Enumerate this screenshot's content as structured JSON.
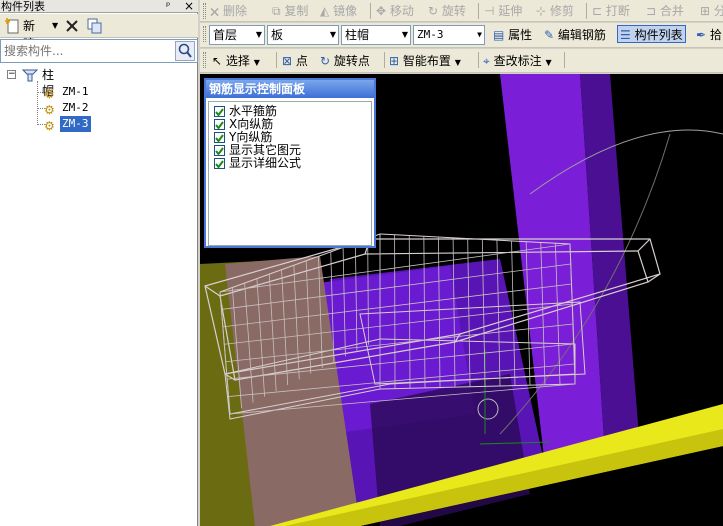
{
  "left_panel": {
    "title": "构件列表",
    "pin_glyph": "ᵖ",
    "close_glyph": "×",
    "new_label": "新建",
    "search_placeholder": "搜索构件...",
    "tree": {
      "root_label": "柱帽",
      "children": [
        "ZM-1",
        "ZM-2",
        "ZM-3"
      ],
      "selected_index": 2
    }
  },
  "toolbar1": {
    "buttons": [
      {
        "label": "删除",
        "enabled": false,
        "icon": "delete-icon"
      },
      {
        "label": "复制",
        "enabled": false,
        "icon": "copy-icon"
      },
      {
        "label": "镜像",
        "enabled": false,
        "icon": "mirror-icon"
      },
      {
        "label": "移动",
        "enabled": false,
        "icon": "move-icon"
      },
      {
        "label": "旋转",
        "enabled": false,
        "icon": "rotate-icon"
      },
      {
        "label": "延伸",
        "enabled": false,
        "icon": "extend-icon"
      },
      {
        "label": "修剪",
        "enabled": false,
        "icon": "trim-icon"
      },
      {
        "label": "打断",
        "enabled": false,
        "icon": "break-icon"
      },
      {
        "label": "合并",
        "enabled": false,
        "icon": "merge-icon"
      },
      {
        "label": "分",
        "enabled": false,
        "icon": "split-icon"
      }
    ]
  },
  "toolbar2": {
    "floor": "首层",
    "category": "板",
    "type": "柱帽",
    "component": "ZM-3",
    "properties_label": "属性",
    "edit_rebar_label": "编辑钢筋",
    "component_list_label": "构件列表",
    "extra_label": "拾"
  },
  "toolbar3": {
    "select_label": "选择",
    "point_label": "点",
    "rotate_point_label": "旋转点",
    "smart_layout_label": "智能布置",
    "check_annotation_label": "查改标注"
  },
  "rebar_panel": {
    "title": "钢筋显示控制面板",
    "options": [
      {
        "label": "水平箍筋",
        "checked": true
      },
      {
        "label": "X向纵筋",
        "checked": true
      },
      {
        "label": "Y向纵筋",
        "checked": true
      },
      {
        "label": "显示其它图元",
        "checked": true
      },
      {
        "label": "显示详细公式",
        "checked": true
      }
    ]
  },
  "colors": {
    "viewport_bg": "#000000",
    "purple_column": "#7a1ed8",
    "dark_purple": "#3a0b6e",
    "olive": "#6b6b12",
    "pink": "#8a6a64",
    "yellow": "#e8e81a",
    "rebar_wire": "#d8d0d0",
    "selection_blue": "#316ac5"
  }
}
